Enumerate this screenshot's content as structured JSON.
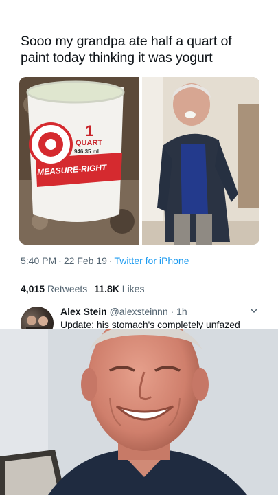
{
  "tweet": {
    "text": "Sooo my grandpa ate half a quart of paint today thinking it was yogurt",
    "time": "5:40 PM",
    "date": "22 Feb 19",
    "source": "Twitter for iPhone",
    "retweets_count": "4,015",
    "retweets_label": "Retweets",
    "likes_count": "11.8K",
    "likes_label": "Likes"
  },
  "paint_can": {
    "brand": "MEASURE-RIGHT",
    "size": "1",
    "unit": "QUART",
    "ml": "946,35 ml"
  },
  "reply": {
    "name": "Alex Stein",
    "handle": "@alexsteinnn",
    "age": "1h",
    "text": "Update: his stomach's completely unfazed"
  },
  "icons": [
    "reply-icon",
    "retweet-icon",
    "like-icon",
    "share-icon",
    "chevron-down-icon"
  ],
  "colors": {
    "link": "#1d9bf0",
    "muted": "#536471",
    "text": "#0f1419"
  }
}
